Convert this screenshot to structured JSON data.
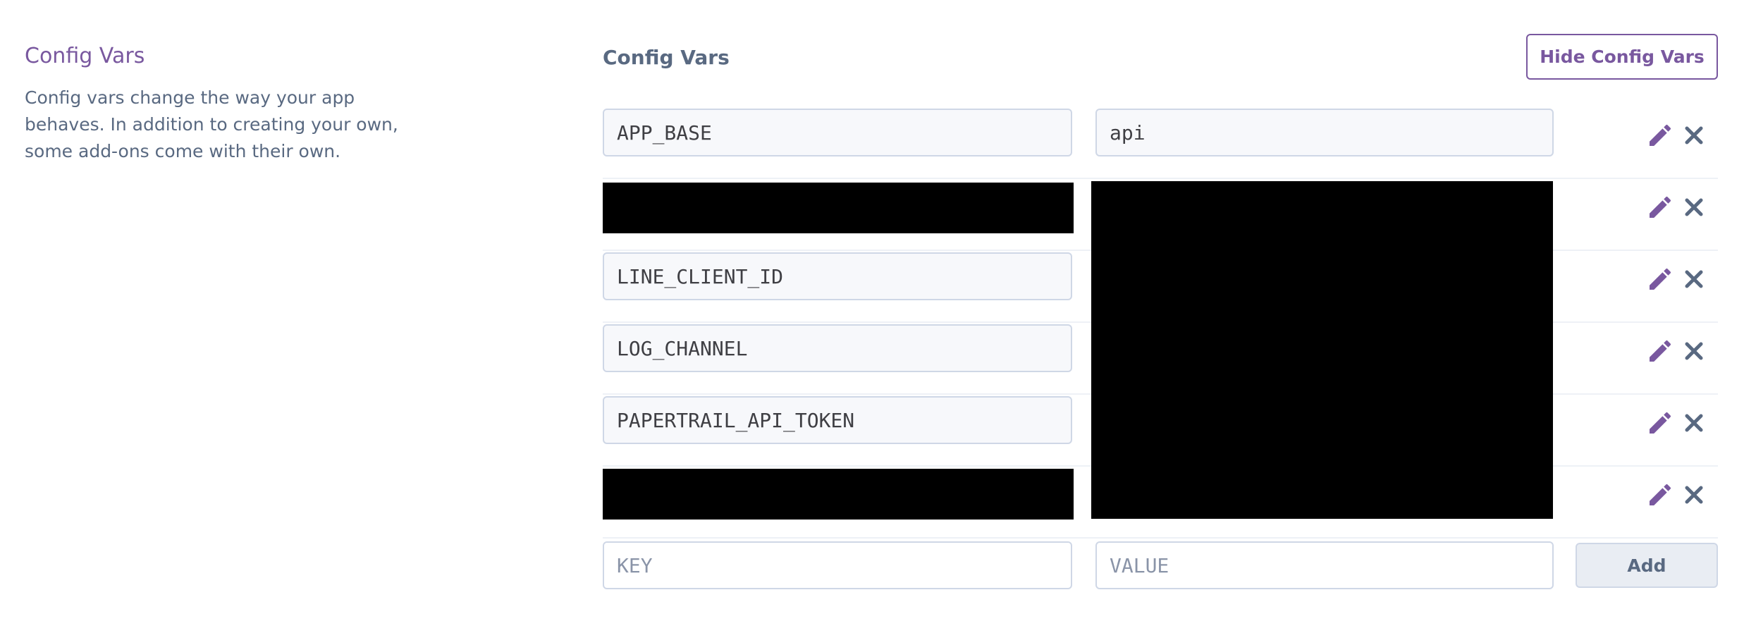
{
  "sidebar": {
    "title": "Config Vars",
    "description": "Config vars change the way your app behaves. In addition to creating your own, some add-ons come with their own."
  },
  "main": {
    "title": "Config Vars",
    "hide_button": "Hide Config Vars"
  },
  "config_vars": [
    {
      "key": "APP_BASE",
      "value": "api",
      "redacted_key": false,
      "redacted_value": false
    },
    {
      "key": "",
      "value": "",
      "redacted_key": true,
      "redacted_value": true
    },
    {
      "key": "LINE_CLIENT_ID",
      "value": "",
      "redacted_key": false,
      "redacted_value": true
    },
    {
      "key": "LOG_CHANNEL",
      "value": "",
      "redacted_key": false,
      "redacted_value": true
    },
    {
      "key": "PAPERTRAIL_API_TOKEN",
      "value": "",
      "redacted_key": false,
      "redacted_value": true
    },
    {
      "key": "",
      "value": "",
      "redacted_key": true,
      "redacted_value": true
    }
  ],
  "new_var": {
    "key_placeholder": "KEY",
    "value_placeholder": "VALUE",
    "add_label": "Add"
  },
  "icons": {
    "edit": "pencil-icon",
    "delete": "close-icon"
  },
  "colors": {
    "accent": "#79589f",
    "text_muted": "#596981",
    "border": "#cfd7e6"
  }
}
